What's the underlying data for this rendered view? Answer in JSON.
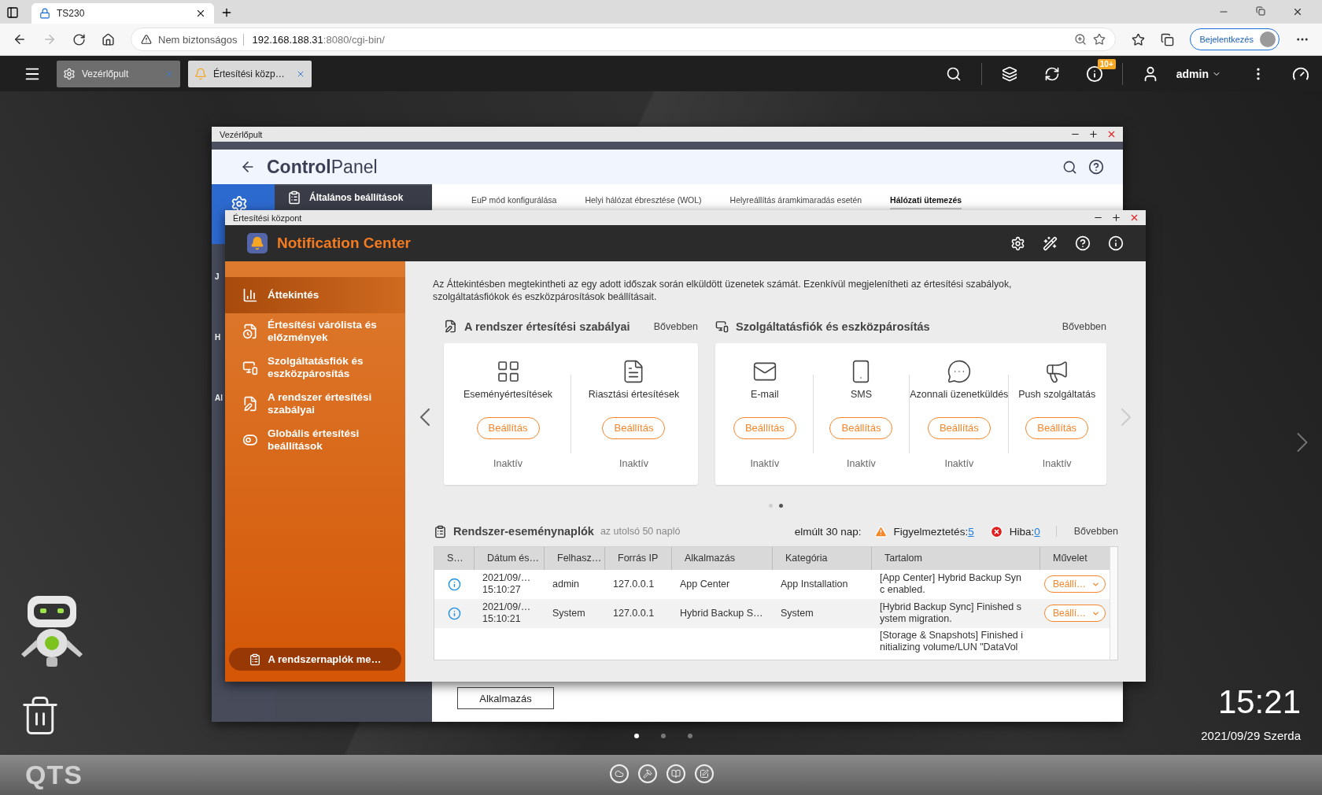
{
  "browser": {
    "tab_title": "TS230",
    "security": "Nem biztonságos",
    "url_host": "192.168.188.31",
    "url_path": ":8080/cgi-bin/",
    "sign_in": "Bejelentkezés"
  },
  "qts_bar": {
    "tabs": [
      {
        "label": "Vezérlőpult",
        "kind": "settings",
        "selected": false
      },
      {
        "label": "Értesítési közp…",
        "kind": "notification",
        "selected": true
      }
    ],
    "notification_badge": "10+",
    "user": "admin"
  },
  "control_panel": {
    "title": "Vezérlőpult",
    "brand_bold": "Control",
    "brand_light": "Panel",
    "menu_item": "Általános beállítások",
    "sidebar_fragments": [
      "J",
      "H",
      "Al"
    ],
    "tabs": [
      {
        "label": "EuP mód konfigurálása",
        "selected": false
      },
      {
        "label": "Helyi hálózat ébresztése (WOL)",
        "selected": false
      },
      {
        "label": "Helyreállítás áramkimaradás esetén",
        "selected": false
      },
      {
        "label": "Hálózati ütemezés",
        "selected": true
      }
    ],
    "apply_button": "Alkalmazás"
  },
  "notification_center": {
    "window_title": "Értesítési központ",
    "app_title": "Notification Center",
    "sidebar": [
      {
        "label": "Áttekintés",
        "kind": "overview",
        "selected": true
      },
      {
        "label": "Értesítési várólista és előzmények",
        "kind": "queue",
        "selected": false
      },
      {
        "label": "Szolgáltatásfiók és eszközpárosítás",
        "kind": "devices",
        "selected": false
      },
      {
        "label": "A rendszer értesítési szabályai",
        "kind": "rules",
        "selected": false
      },
      {
        "label": "Globális értesítési beállítások",
        "kind": "global",
        "selected": false
      }
    ],
    "sidebar_button": "A rendszernaplók me…",
    "description": "Az Áttekintésben megtekintheti az egy adott időszak során elküldött üzenetek számát. Ezenkívül megjelenítheti az értesítési szabályok, szolgáltatásfiókok és eszközpárosítások beállításait.",
    "sections": [
      {
        "title": "A rendszer értesítési szabályai",
        "kind": "rules",
        "more": "Bővebben",
        "items": [
          {
            "label": "Eseményértesítések",
            "kind": "events",
            "button": "Beállítás",
            "status": "Inaktív"
          },
          {
            "label": "Riasztási értesítések",
            "kind": "alerts",
            "button": "Beállítás",
            "status": "Inaktív"
          }
        ]
      },
      {
        "title": "Szolgáltatásfiók és eszközpárosítás",
        "kind": "devices",
        "more": "Bővebben",
        "items": [
          {
            "label": "E-mail",
            "kind": "email",
            "button": "Beállítás",
            "status": "Inaktív"
          },
          {
            "label": "SMS",
            "kind": "sms",
            "button": "Beállítás",
            "status": "Inaktív"
          },
          {
            "label": "Azonnali üzenetküldés",
            "kind": "im",
            "button": "Beállítás",
            "status": "Inaktív"
          },
          {
            "label": "Push szolgáltatás",
            "kind": "push",
            "button": "Beállítás",
            "status": "Inaktív"
          }
        ]
      }
    ],
    "pager": [
      {
        "selected": false
      },
      {
        "selected": true
      }
    ],
    "logs": {
      "title": "Rendszer-eseménynaplók",
      "subtitle": "az utolsó 50 napló",
      "period": "elmúlt 30 nap:",
      "warning_label": "Figyelmeztetés:",
      "warning_count": "5",
      "error_label": "Hiba:",
      "error_count": "0",
      "more": "Bővebben",
      "columns": [
        "S…",
        "Dátum és…",
        "Felhasz…",
        "Forrás IP",
        "Alkalmazás",
        "Kategória",
        "Tartalom",
        "Művelet"
      ],
      "rows": [
        {
          "kind": "info",
          "date": "2021/09/…",
          "time": "15:10:27",
          "user": "admin",
          "ip": "127.0.0.1",
          "app": "App Center",
          "category": "App Installation",
          "content": "[App Center] Hybrid Backup Sync enabled.",
          "action": "Beállí…"
        },
        {
          "kind": "info",
          "date": "2021/09/…",
          "time": "15:10:21",
          "user": "System",
          "ip": "127.0.0.1",
          "app": "Hybrid Backup S…",
          "category": "System",
          "content": "[Hybrid Backup Sync] Finished system migration.",
          "action": "Beállí…"
        },
        {
          "kind": "partial",
          "content": "[Storage & Snapshots] Finished initializing volume/LUN \"DataVol"
        }
      ]
    }
  },
  "desktop": {
    "clock": "15:21",
    "date": "2021/09/29 Szerda",
    "pages": [
      {
        "selected": true
      },
      {
        "selected": false
      },
      {
        "selected": false
      }
    ],
    "logo": "QTS"
  }
}
